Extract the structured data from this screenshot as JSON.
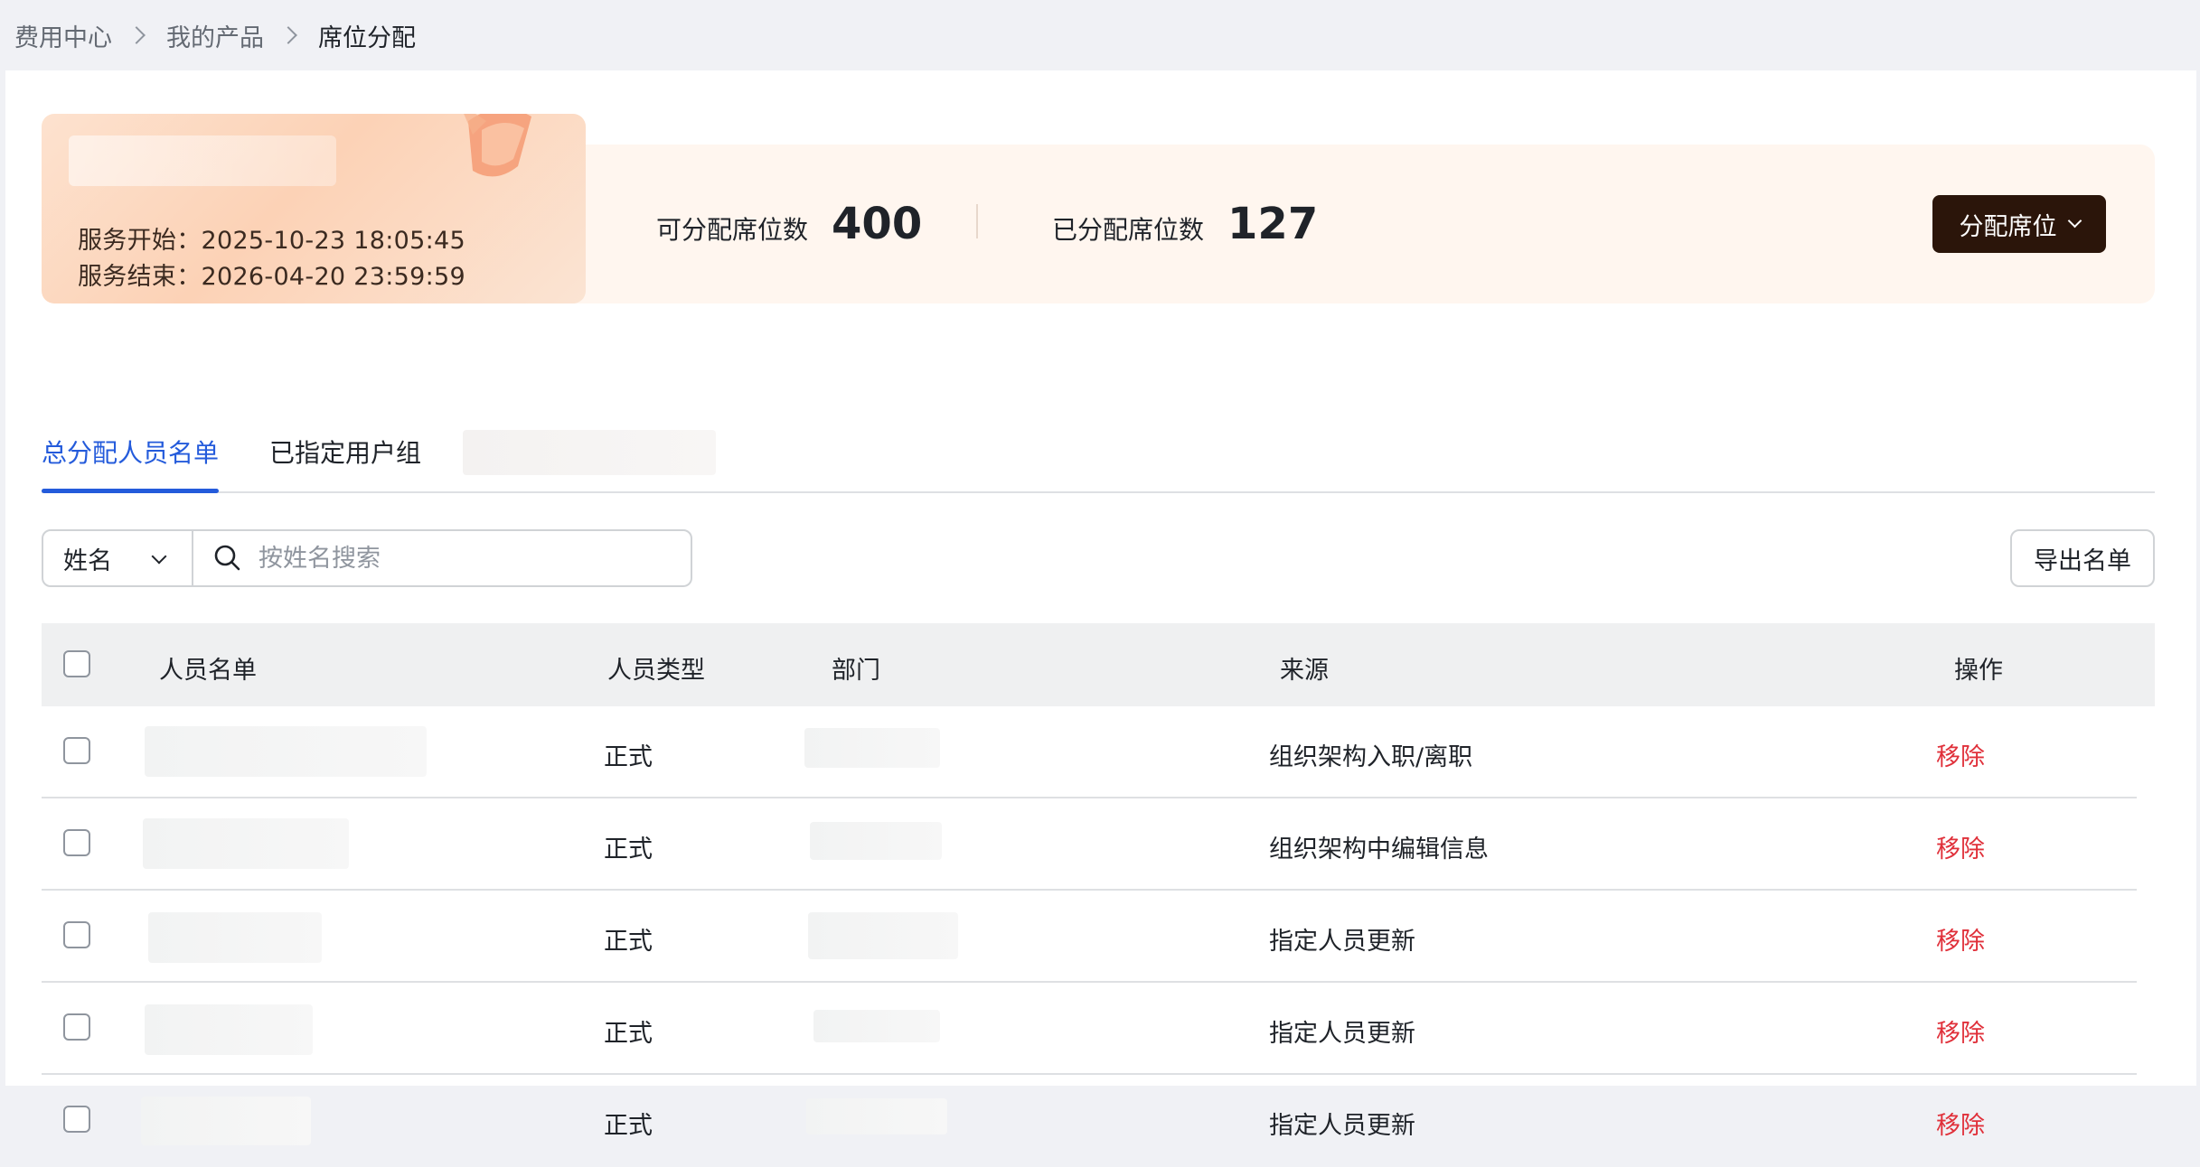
{
  "breadcrumb": {
    "items": [
      "费用中心",
      "我的产品",
      "席位分配"
    ]
  },
  "service": {
    "start": "服务开始：2025-10-23 18:05:45",
    "end": "服务结束：2026-04-20 23:59:59"
  },
  "stats": {
    "available_label": "可分配席位数",
    "available_value": "400",
    "assigned_label": "已分配席位数",
    "assigned_value": "127"
  },
  "allocate_button": "分配席位",
  "tabs": [
    {
      "label": "总分配人员名单",
      "active": true
    },
    {
      "label": "已指定用户组",
      "active": false
    }
  ],
  "filter": {
    "field": "姓名",
    "search_placeholder": "按姓名搜索"
  },
  "export_button": "导出名单",
  "table": {
    "columns": [
      "人员名单",
      "人员类型",
      "部门",
      "来源",
      "操作"
    ],
    "rows": [
      {
        "type": "正式",
        "source": "组织架构入职/离职",
        "action": "移除"
      },
      {
        "type": "正式",
        "source": "组织架构中编辑信息",
        "action": "移除"
      },
      {
        "type": "正式",
        "source": "指定人员更新",
        "action": "移除"
      },
      {
        "type": "正式",
        "source": "指定人员更新",
        "action": "移除"
      },
      {
        "type": "正式",
        "source": "指定人员更新",
        "action": "移除"
      }
    ]
  },
  "colors": {
    "accent": "#245bdb",
    "danger": "#e0303a",
    "button_dark": "#2b150a",
    "banner_bg": "#fff6ef"
  }
}
